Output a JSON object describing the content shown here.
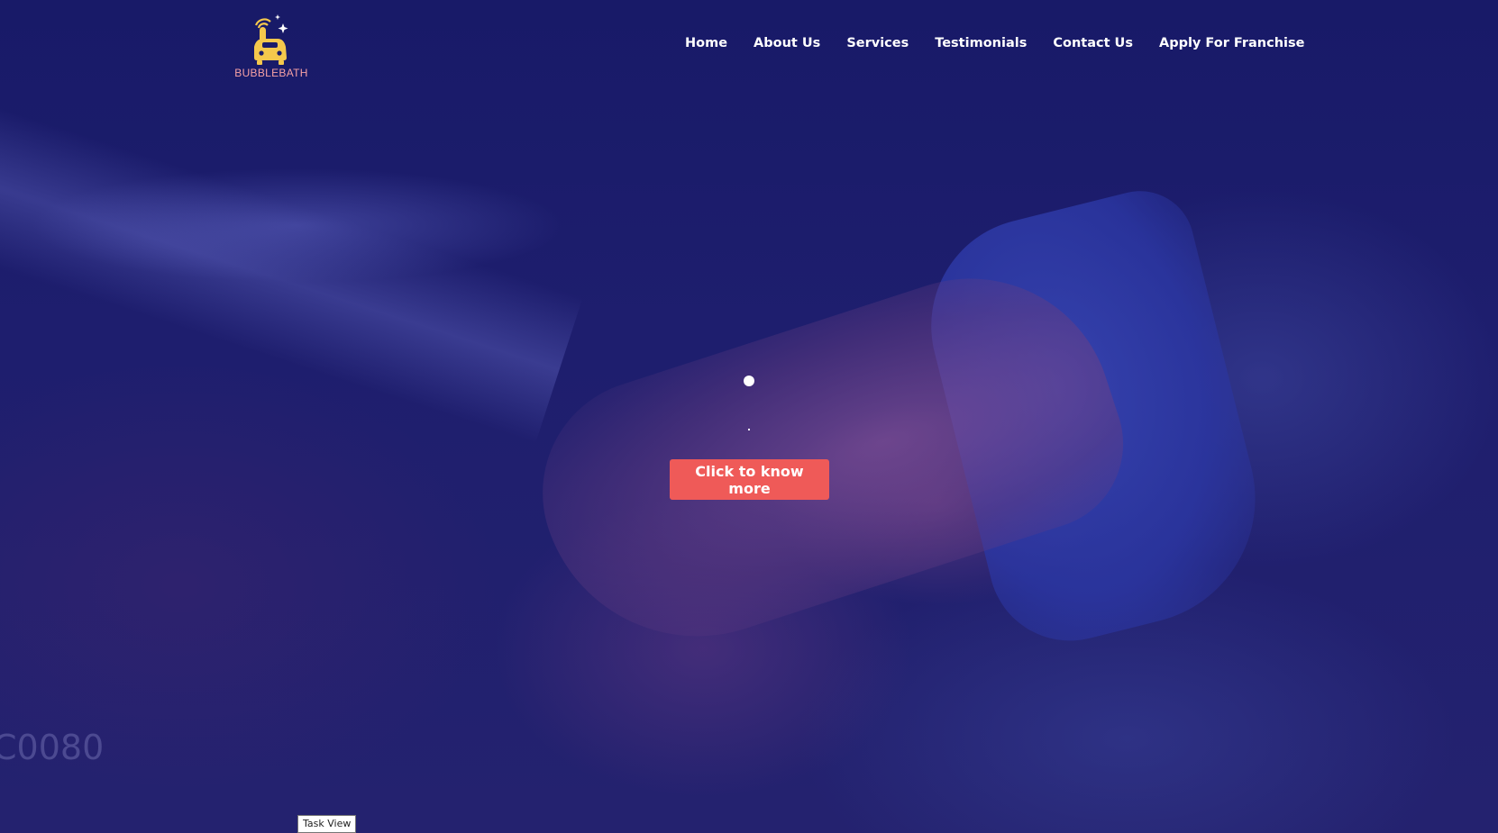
{
  "brand": {
    "name": "BUBBLEBATH",
    "colors": {
      "logo_primary": "#f5c84c",
      "logo_text": "#f6a1a5"
    }
  },
  "nav": {
    "items": [
      {
        "label": "Home"
      },
      {
        "label": "About Us"
      },
      {
        "label": "Services"
      },
      {
        "label": "Testimonials"
      },
      {
        "label": "Contact Us"
      },
      {
        "label": "Apply For Franchise"
      }
    ]
  },
  "hero": {
    "slider_indicator": "dot",
    "cta_label": "Click to know more",
    "cta_color": "#ef5a58",
    "overlay_color": "#1a1b6a"
  },
  "overlay": {
    "watermark_text": "C0080"
  },
  "tooltip": {
    "text": "Task View"
  }
}
